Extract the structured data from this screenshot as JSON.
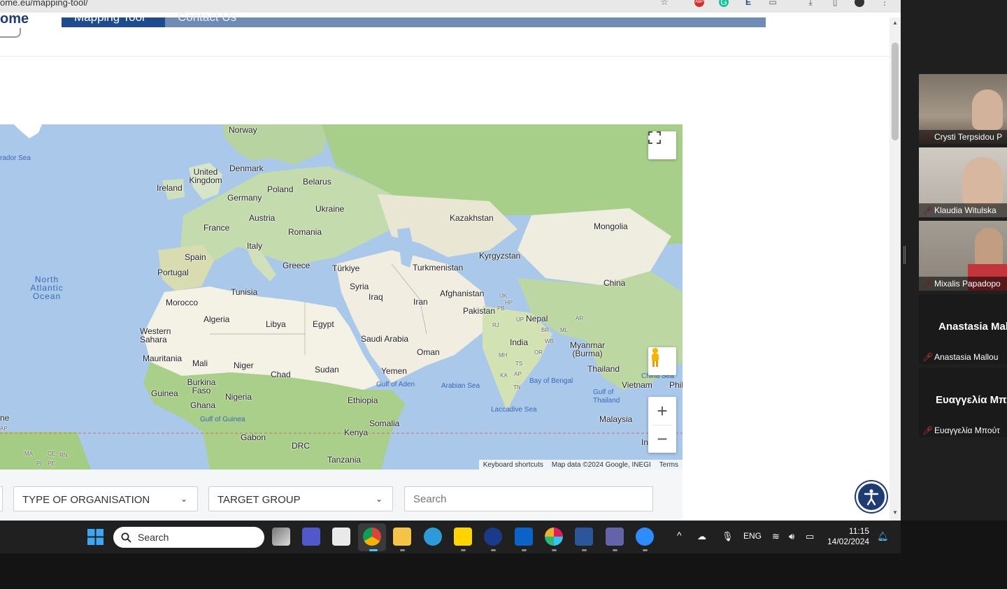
{
  "browser": {
    "url": "ome.eu/mapping-tool/",
    "toolbar_icons": [
      "star-icon",
      "adblock-icon",
      "grammarly-icon",
      "extension-icon",
      "puzzle-icon",
      "download-icon",
      "sidepanel-icon",
      "profile-icon",
      "menu-icon"
    ]
  },
  "site": {
    "logo_text": "ome",
    "nav": {
      "active_label": "Mapping Tool",
      "other_label": "Contact Us"
    },
    "colors": {
      "nav_active": "#1f4c8f",
      "nav_bar": "#6f8bb8"
    }
  },
  "map": {
    "countries": [
      "Norway",
      "Denmark",
      "United Kingdom",
      "Ireland",
      "Belarus",
      "Poland",
      "Germany",
      "Ukraine",
      "Austria",
      "France",
      "Romania",
      "Italy",
      "Spain",
      "Greece",
      "Portugal",
      "Türkiye",
      "Turkmenistan",
      "Kazakhstan",
      "Kyrgyzstan",
      "Mongolia",
      "Syria",
      "Iraq",
      "Iran",
      "Afghanistan",
      "Tunisia",
      "Morocco",
      "Algeria",
      "Libya",
      "Egypt",
      "Pakistan",
      "Nepal",
      "China",
      "India",
      "Saudi Arabia",
      "Oman",
      "Western Sahara",
      "Mauritania",
      "Mali",
      "Niger",
      "Chad",
      "Sudan",
      "Yemen",
      "Myanmar (Burma)",
      "Thailand",
      "Vietnam",
      "Phil",
      "Burkina Faso",
      "Guinea",
      "Nigeria",
      "Ghana",
      "Ethiopia",
      "Somalia",
      "Malaysia",
      "Kenya",
      "Gabon",
      "DRC",
      "Tanzania",
      "In",
      "ne"
    ],
    "small_codes": [
      "UP",
      "PB",
      "HP",
      "UK",
      "RJ",
      "BR",
      "WB",
      "MH",
      "TS",
      "KA",
      "AP",
      "TN",
      "OR",
      "ML",
      "AR",
      "CE",
      "RN",
      "PI",
      "PE",
      "MA",
      "AP"
    ],
    "seas": [
      "rador Sea",
      "Gulf of Aden",
      "Arabian Sea",
      "Bay of Bengal",
      "Laccadive Sea",
      "Gulf of Guinea",
      "China Sea",
      "Gulf of Thailand"
    ],
    "ocean": "North Atlantic Ocean",
    "attribution": {
      "shortcuts": "Keyboard shortcuts",
      "data": "Map data ©2024 Google, INEGI",
      "terms": "Terms"
    },
    "controls": [
      "fullscreen-icon",
      "pegman-icon",
      "zoom-in-icon",
      "zoom-out-icon"
    ]
  },
  "filters": {
    "type_of_organisation": "TYPE OF ORGANISATION",
    "target_group": "TARGET GROUP",
    "search_placeholder": "Search"
  },
  "participants": [
    {
      "name": "Crysti Terpsidou P",
      "muted": true,
      "video": true,
      "bg": "#8a7d6e"
    },
    {
      "name": "Klaudia Witulska",
      "muted": true,
      "video": true,
      "bg": "#b9b4ac"
    },
    {
      "name": "Mixalis Papadopo",
      "muted": true,
      "video": true,
      "bg": "#9a9288"
    },
    {
      "name": "Anastasia Mallou",
      "display": "Anastasia Mal",
      "muted": true,
      "video": false
    },
    {
      "name": "Ευαγγελία Μπούτ",
      "display": "Ευαγγελία Μπ",
      "muted": true,
      "video": false
    }
  ],
  "taskbar": {
    "search_label": "Search",
    "tray": {
      "language": "ENG",
      "time": "11:15",
      "date": "14/02/2024"
    },
    "apps": [
      "task-view-icon",
      "teams-icon",
      "store-icon",
      "chrome-icon",
      "explorer-icon",
      "help-icon",
      "sticky-notes-icon",
      "app-icon",
      "outlook-icon",
      "slack-icon",
      "word-icon",
      "teams-work-icon",
      "zoom-icon"
    ]
  }
}
